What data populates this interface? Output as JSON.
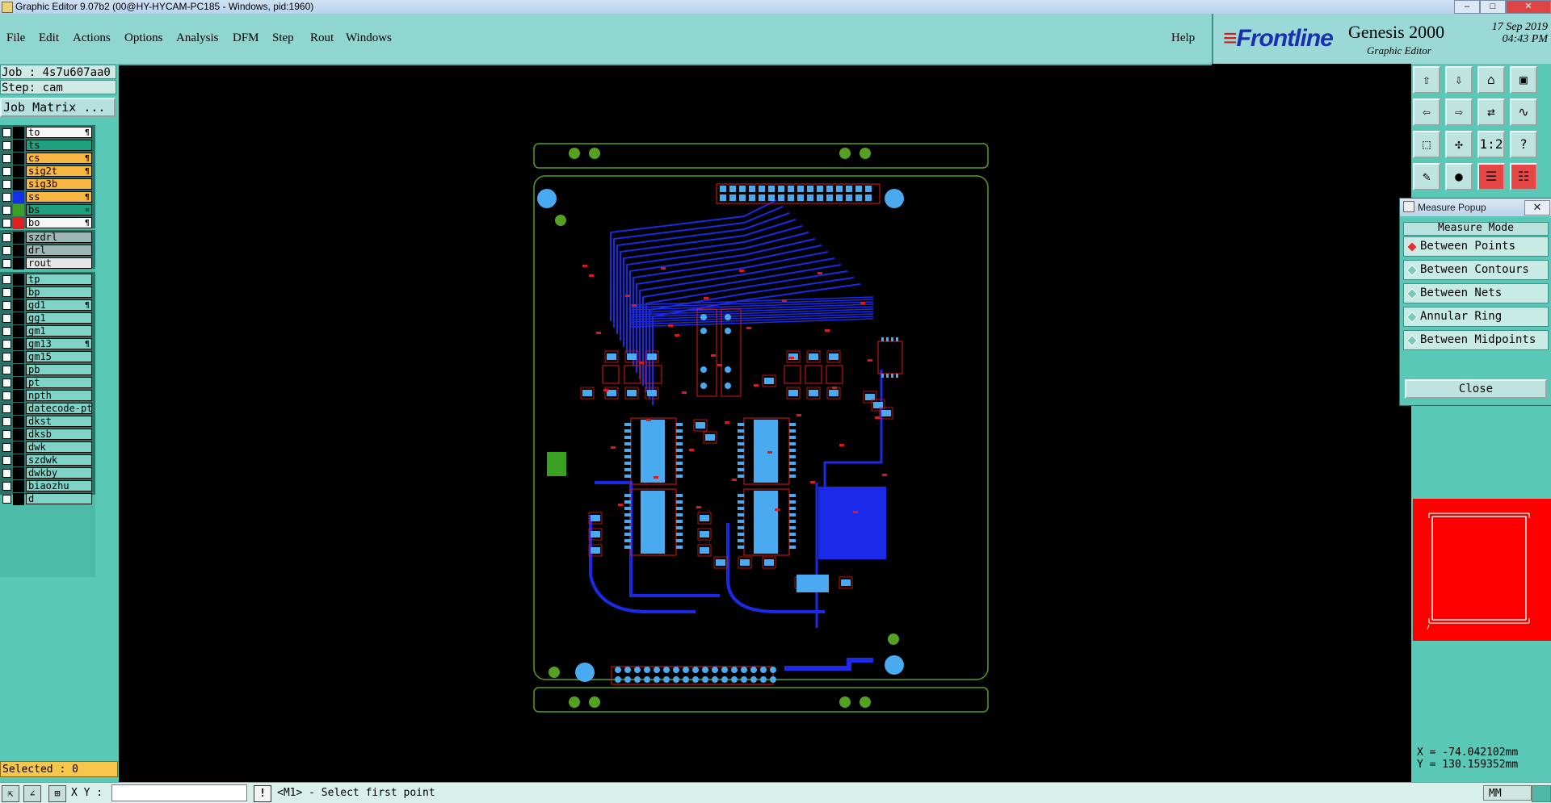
{
  "window": {
    "title": "Graphic Editor 9.07b2 (00@HY-HYCAM-PC185 - Windows, pid:1960)"
  },
  "menu": {
    "items": [
      "File",
      "Edit",
      "Actions",
      "Options",
      "Analysis",
      "DFM",
      "Step",
      "Rout",
      "Windows"
    ],
    "help": "Help"
  },
  "brand": {
    "logo": "Frontline",
    "product": "Genesis 2000",
    "subtitle": "Graphic Editor",
    "date": "17 Sep 2019",
    "time": "04:43 PM"
  },
  "job": {
    "job_label": "Job : 4s7u607aa0",
    "step_label": "Step: cam",
    "matrix_button": "Job Matrix ..."
  },
  "layers": [
    {
      "name": "to",
      "color": "#f6f6f6",
      "swatch": "#000000",
      "mark": "¶",
      "group": 1
    },
    {
      "name": "ts",
      "color": "#1fa07e",
      "swatch": "#000000",
      "mark": "",
      "group": 1
    },
    {
      "name": "cs",
      "color": "#f7b742",
      "swatch": "#000000",
      "mark": "¶",
      "group": 1
    },
    {
      "name": "sig2t",
      "color": "#f7b742",
      "swatch": "#000000",
      "mark": "¶",
      "group": 1
    },
    {
      "name": "sig3b",
      "color": "#f7b742",
      "swatch": "#000000",
      "mark": "",
      "group": 1
    },
    {
      "name": "ss",
      "color": "#f7b742",
      "swatch": "#1230e6",
      "mark": "¶",
      "group": 1
    },
    {
      "name": "bs",
      "color": "#1fa07e",
      "swatch": "#3aa021",
      "mark": "¤",
      "group": 1
    },
    {
      "name": "bo",
      "color": "#f6f6f6",
      "swatch": "#e02020",
      "mark": "¶",
      "group": 1
    },
    {
      "name": "szdrl",
      "color": "#9fb6b6",
      "swatch": "#000000",
      "mark": "",
      "group": 2
    },
    {
      "name": "drl",
      "color": "#9fb6b6",
      "swatch": "#000000",
      "mark": "",
      "group": 2
    },
    {
      "name": "rout",
      "color": "#e6e6e6",
      "swatch": "#000000",
      "mark": "",
      "group": 2
    },
    {
      "name": "tp",
      "color": "#7fd3c7",
      "swatch": "#000000",
      "mark": "",
      "group": 3
    },
    {
      "name": "bp",
      "color": "#7fd3c7",
      "swatch": "#000000",
      "mark": "",
      "group": 3
    },
    {
      "name": "gd1",
      "color": "#7fd3c7",
      "swatch": "#000000",
      "mark": "¶",
      "group": 3
    },
    {
      "name": "gg1",
      "color": "#7fd3c7",
      "swatch": "#000000",
      "mark": "",
      "group": 3
    },
    {
      "name": "gm1",
      "color": "#7fd3c7",
      "swatch": "#000000",
      "mark": "",
      "group": 3
    },
    {
      "name": "gm13",
      "color": "#7fd3c7",
      "swatch": "#000000",
      "mark": "¶",
      "group": 3
    },
    {
      "name": "gm15",
      "color": "#7fd3c7",
      "swatch": "#000000",
      "mark": "",
      "group": 3
    },
    {
      "name": "pb",
      "color": "#7fd3c7",
      "swatch": "#000000",
      "mark": "",
      "group": 3
    },
    {
      "name": "pt",
      "color": "#7fd3c7",
      "swatch": "#000000",
      "mark": "",
      "group": 3
    },
    {
      "name": "npth",
      "color": "#7fd3c7",
      "swatch": "#000000",
      "mark": "",
      "group": 3
    },
    {
      "name": "datecode-pt",
      "color": "#7fd3c7",
      "swatch": "#000000",
      "mark": "",
      "group": 3
    },
    {
      "name": "dkst",
      "color": "#7fd3c7",
      "swatch": "#000000",
      "mark": "",
      "group": 3
    },
    {
      "name": "dksb",
      "color": "#7fd3c7",
      "swatch": "#000000",
      "mark": "",
      "group": 3
    },
    {
      "name": "dwk",
      "color": "#7fd3c7",
      "swatch": "#000000",
      "mark": "",
      "group": 3
    },
    {
      "name": "szdwk",
      "color": "#7fd3c7",
      "swatch": "#000000",
      "mark": "",
      "group": 3
    },
    {
      "name": "dwkby",
      "color": "#7fd3c7",
      "swatch": "#000000",
      "mark": "",
      "group": 3
    },
    {
      "name": "biaozhu",
      "color": "#7fd3c7",
      "swatch": "#000000",
      "mark": "",
      "group": 3
    },
    {
      "name": "d",
      "color": "#7fd3c7",
      "swatch": "#000000",
      "mark": "",
      "group": 3
    }
  ],
  "status": {
    "selected": "Selected : 0",
    "xy_label": "X Y :",
    "xy_value": "",
    "prompt": "<M1> - Select first point",
    "units": "MM"
  },
  "coords": {
    "x": "X = -74.042102mm",
    "y": "Y = 130.159352mm"
  },
  "measure_popup": {
    "title": "Measure Popup",
    "mode_title": "Measure Mode",
    "options": [
      "Between Points",
      "Between Contours",
      "Between Nets",
      "Annular Ring",
      "Between Midpoints"
    ],
    "selected_index": 0,
    "close_label": "Close"
  },
  "toolbar_icons": [
    "step-up-icon",
    "step-down-icon",
    "home-icon",
    "panel-icon",
    "move-left-icon",
    "move-right-icon",
    "mirror-icon",
    "snap-icon",
    "zoom-fit-icon",
    "pan-icon",
    "scale-1-2-icon",
    "help-icon",
    "edit-note-icon",
    "probe-icon",
    "layer-toggle-icon",
    "layer-order-icon"
  ],
  "colors": {
    "panel": "#5ac8b6",
    "menubar": "#8fd6d1",
    "board_outline": "#56a021",
    "copper": "#1a2ae8",
    "pads": "#4aaaf0",
    "silk": "#e01818"
  }
}
